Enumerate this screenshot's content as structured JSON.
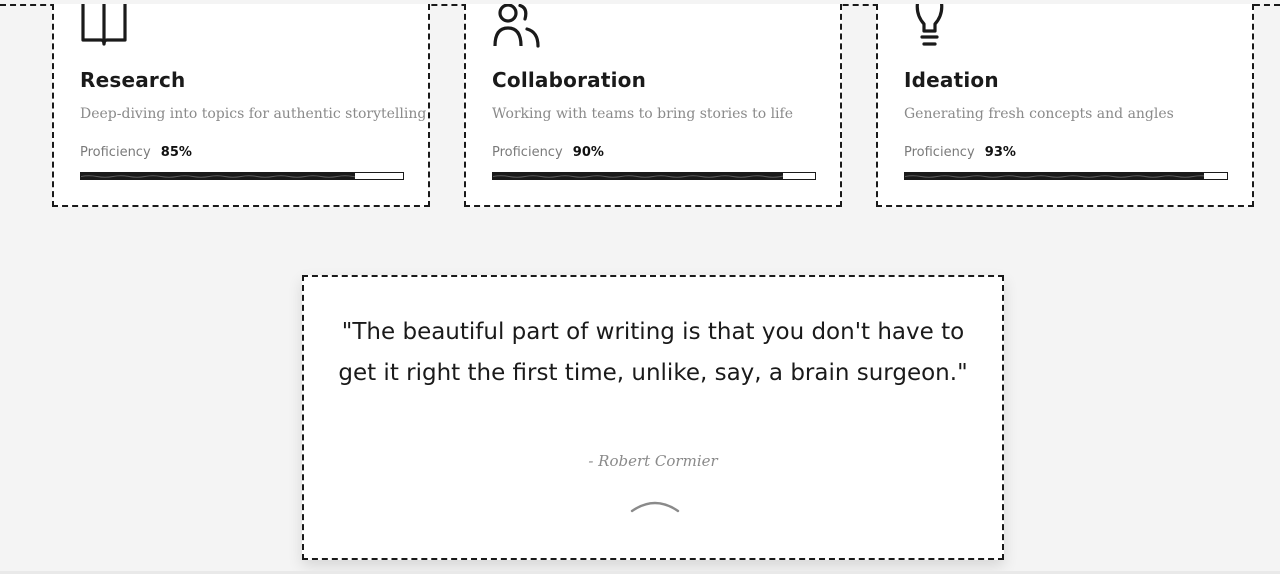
{
  "skills": [
    {
      "icon": "open-book-icon",
      "title": "Research",
      "description": "Deep-diving into topics for authentic storytelling",
      "proficiency_label": "Proficiency",
      "proficiency_value": "85%",
      "proficiency_fraction": 0.85
    },
    {
      "icon": "users-icon",
      "title": "Collaboration",
      "description": "Working with teams to bring stories to life",
      "proficiency_label": "Proficiency",
      "proficiency_value": "90%",
      "proficiency_fraction": 0.9
    },
    {
      "icon": "lightbulb-icon",
      "title": "Ideation",
      "description": "Generating fresh concepts and angles",
      "proficiency_label": "Proficiency",
      "proficiency_value": "93%",
      "proficiency_fraction": 0.93
    }
  ],
  "quote": {
    "text": "\"The beautiful part of writing is that you don't have to get it right the first time, unlike, say, a brain surgeon.\"",
    "author": "- Robert Cormier"
  },
  "colors": {
    "background": "#f4f4f4",
    "card": "#ffffff",
    "ink": "#1a1a1a",
    "muted": "#8a8a8a"
  }
}
